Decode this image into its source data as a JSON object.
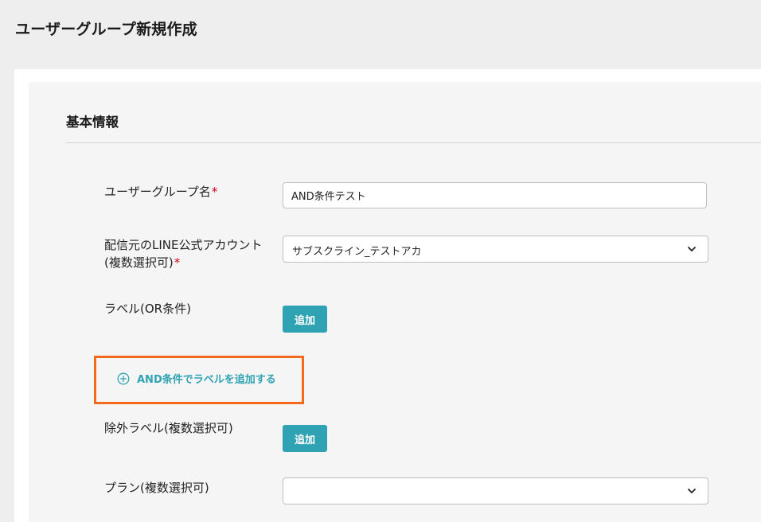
{
  "page": {
    "title": "ユーザーグループ新規作成"
  },
  "section": {
    "title": "基本情報"
  },
  "form": {
    "group_name": {
      "label": "ユーザーグループ名",
      "required_mark": "*",
      "value": "AND条件テスト"
    },
    "line_account": {
      "label_line1": "配信元のLINE公式アカウント",
      "label_line2": "(複数選択可)",
      "required_mark": "*",
      "selected_value": "サブスクライン_テストアカ"
    },
    "label_or": {
      "label": "ラベル(OR条件)",
      "add_button": "追加"
    },
    "and_condition_link": {
      "label": "AND条件でラベルを追加する",
      "icon": "plus-circle-icon"
    },
    "exclude_label": {
      "label": "除外ラベル(複数選択可)",
      "add_button": "追加"
    },
    "plan": {
      "label": "プラン(複数選択可)",
      "selected_value": ""
    }
  },
  "colors": {
    "accent": "#2fa3b3",
    "highlight": "#f26b1d",
    "required": "#d0021b"
  }
}
